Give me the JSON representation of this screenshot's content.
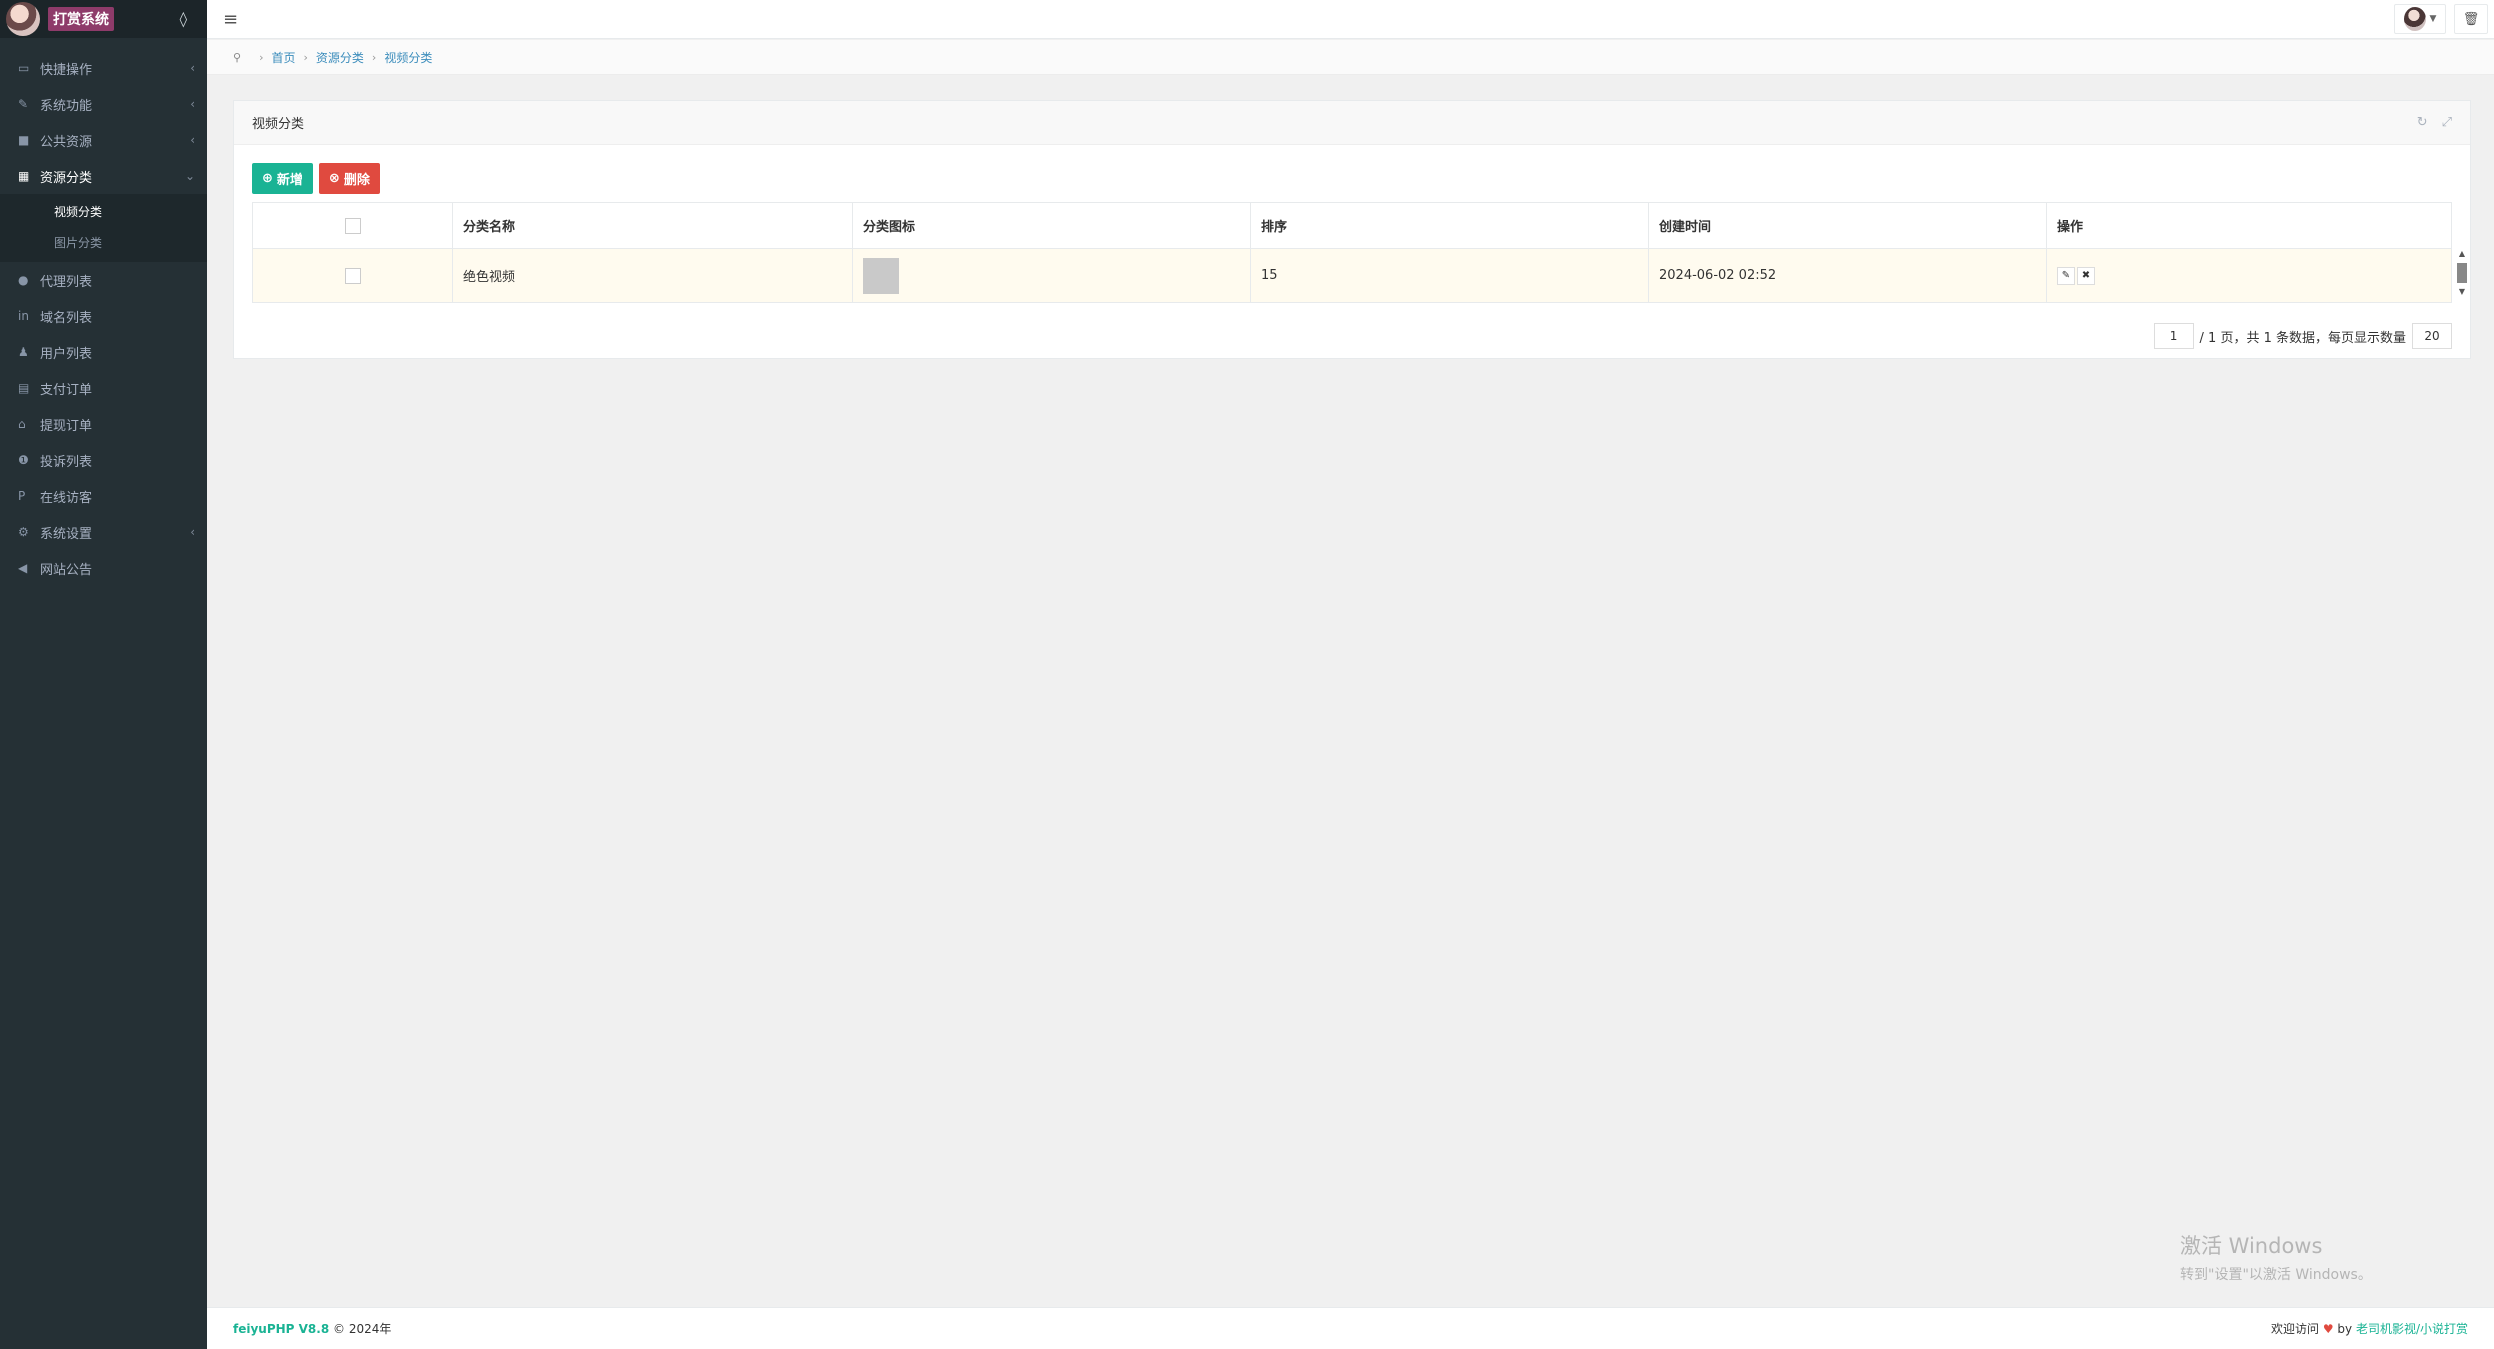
{
  "brand": {
    "title": "打赏系统"
  },
  "sidebar": {
    "items": [
      {
        "label": "快捷操作",
        "icon": "folder-icon",
        "arrow": "‹"
      },
      {
        "label": "系统功能",
        "icon": "pencil-icon",
        "arrow": "‹"
      },
      {
        "label": "公共资源",
        "icon": "video-icon",
        "arrow": "‹"
      },
      {
        "label": "资源分类",
        "icon": "grid-icon",
        "arrow": "⌄"
      },
      {
        "label": "代理列表",
        "icon": "users-icon"
      },
      {
        "label": "域名列表",
        "icon": "linkedin-icon"
      },
      {
        "label": "用户列表",
        "icon": "user-icon"
      },
      {
        "label": "支付订单",
        "icon": "calculator-icon"
      },
      {
        "label": "提现订单",
        "icon": "bank-icon"
      },
      {
        "label": "投诉列表",
        "icon": "info-icon"
      },
      {
        "label": "在线访客",
        "icon": "paypal-icon"
      },
      {
        "label": "系统设置",
        "icon": "gear-icon",
        "arrow": "‹"
      },
      {
        "label": "网站公告",
        "icon": "bullhorn-icon"
      }
    ],
    "subitems": [
      {
        "label": "视频分类"
      },
      {
        "label": "图片分类"
      }
    ]
  },
  "breadcrumb": {
    "home": "首页",
    "section": "资源分类",
    "current": "视频分类"
  },
  "panel": {
    "title": "视频分类",
    "add_label": "新增",
    "delete_label": "删除"
  },
  "table": {
    "headers": [
      "分类名称",
      "分类图标",
      "排序",
      "创建时间",
      "操作"
    ],
    "rows": [
      {
        "name": "绝色视频",
        "sort": "15",
        "created": "2024-06-02 02:52"
      }
    ]
  },
  "pager": {
    "page": "1",
    "total_pages_text": "/ 1 页，共 1 条数据，每页显示数量",
    "page_size": "20"
  },
  "watermark": {
    "title": "激活 Windows",
    "subtitle": "转到\"设置\"以激活 Windows。"
  },
  "footer": {
    "brand": "feiyuPHP V8.8",
    "copyright": "© 2024年",
    "welcome": "欢迎访问",
    "by": "by",
    "link": "老司机影视/小说打赏"
  }
}
